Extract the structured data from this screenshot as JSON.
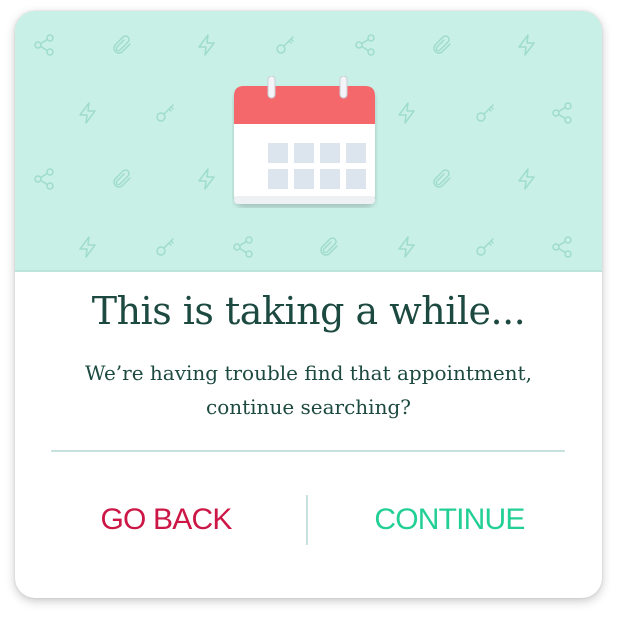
{
  "dialog": {
    "title": "This is taking a while...",
    "message": "We’re having trouble find that appointment, continue searching?"
  },
  "actions": {
    "back_label": "GO BACK",
    "continue_label": "CONTINUE"
  },
  "hero": {
    "illustration": "calendar-icon",
    "pattern_icons": [
      "share-icon",
      "paperclip-icon",
      "lightning-icon",
      "key-icon"
    ]
  },
  "colors": {
    "hero_background": "#c9f0e7",
    "pattern_icon": "#9fdccb",
    "title_text": "#1d4a40",
    "back_button": "#cc1646",
    "continue_button": "#22cf95",
    "divider": "#c7e1df",
    "calendar_header": "#f4676a",
    "calendar_cell": "#dce5ee"
  }
}
